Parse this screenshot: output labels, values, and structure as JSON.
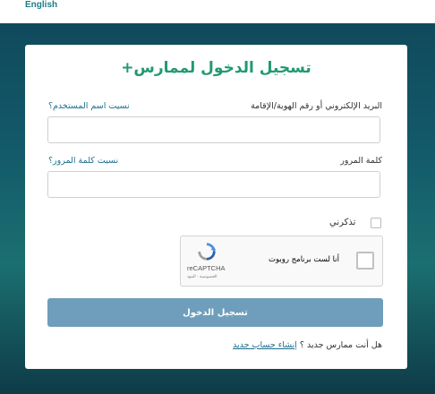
{
  "header": {
    "language_link": "English"
  },
  "login": {
    "title": "تسجيل الدخول لممارس+",
    "username_label": "البريد الإلكتروني أو رقم الهوية/الإقامة",
    "forgot_username": "نسيت اسم المستخدم؟",
    "username_value": "",
    "password_label": "كلمة المرور",
    "forgot_password": "نسيت كلمة المرور؟",
    "password_value": "",
    "remember_me": "تذكرني",
    "submit_label": "تسجيل الدخول",
    "footer_question": "هل أنت ممارس جديد ؟",
    "footer_link": "إنشاء حساب جديد"
  },
  "captcha": {
    "checkbox_label": "أنا لست برنامج روبوت",
    "brand": "reCAPTCHA",
    "terms": "الخصوصية - البنود"
  },
  "colors": {
    "accent_title": "#1f9a70",
    "button": "#6e9ebb",
    "link": "#1e6f8c",
    "background": "#135a6b"
  },
  "icons": [
    "recaptcha-logo-icon"
  ]
}
